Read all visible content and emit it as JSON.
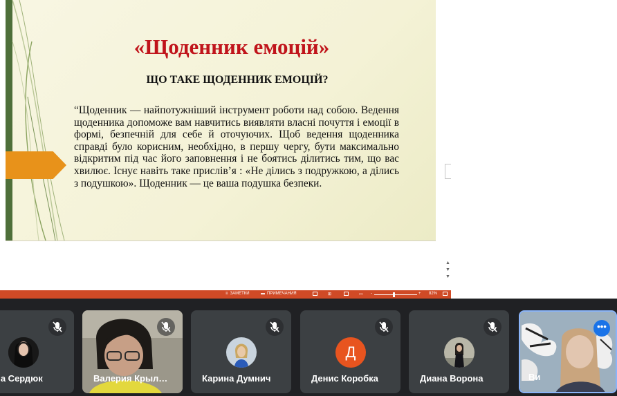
{
  "slide": {
    "title": "«Щоденник емоцій»",
    "subtitle": "ЩО ТАКЕ ЩОДЕННИК ЕМОЦІЙ?",
    "body": "“Щоденник — найпотужніший інструмент роботи над собою. Ведення щоденника допоможе вам навчитись виявляти власні почуття і емоції в формі, безпечній для себе й оточуючих. Щоб ведення щоденника справді було корисним, необхідно, в першу чергу, бути максимально відкритим під час його заповнення і не боятись ділитись тим, що вас хвилює. Існує навіть таке прислів’я : «Не ділись з подружкою, а ділись з подушкою». Щоденник — це ваша подушка безпеки."
  },
  "statusbar": {
    "notes_label": "ЗАМЕТКИ",
    "comments_label": "ПРИМЕЧАНИЯ",
    "zoom_minus": "-",
    "zoom_plus": "+",
    "zoom": "82%"
  },
  "participants": [
    {
      "name": "ша Сердюк",
      "muted": true
    },
    {
      "name": "Валерия Крыл…",
      "muted": true
    },
    {
      "name": "Карина Думнич",
      "muted": true
    },
    {
      "name": "Денис Коробка",
      "initial": "Д",
      "avatar_color": "#e8541f",
      "muted": true
    },
    {
      "name": "Диана Ворона",
      "muted": true
    },
    {
      "name": "Ви",
      "more": "•••"
    }
  ],
  "colors": {
    "title_red": "#c0141b",
    "status_orange": "#d04a26",
    "arrow_orange": "#e8921a",
    "tile_bg": "#3c4043",
    "active_border": "#8ab4f8"
  }
}
